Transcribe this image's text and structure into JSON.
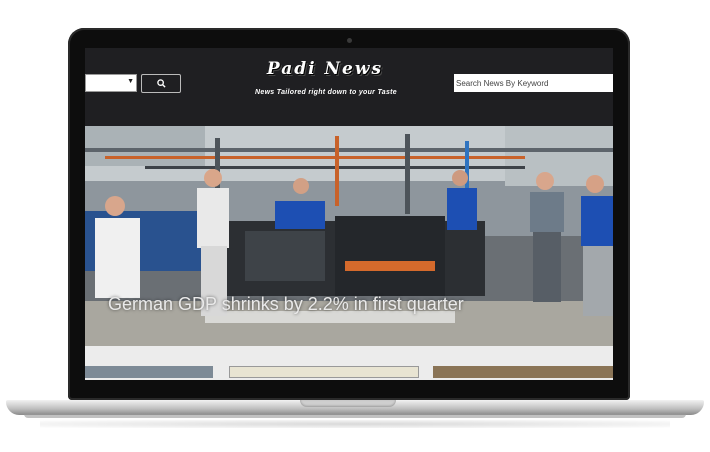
{
  "site": {
    "logo": "Padi News",
    "tagline": "News Tailored right down to your Taste"
  },
  "header": {
    "category_select_value": "",
    "search_placeholder": "Search News By Keyword"
  },
  "hero": {
    "headline": "German GDP shrinks by 2.2% in first quarter"
  },
  "icons": {
    "search_button": "search-icon",
    "select": "chevron-down-icon"
  },
  "colors": {
    "header_bg": "#1f1f22",
    "text": "#ffffff"
  }
}
